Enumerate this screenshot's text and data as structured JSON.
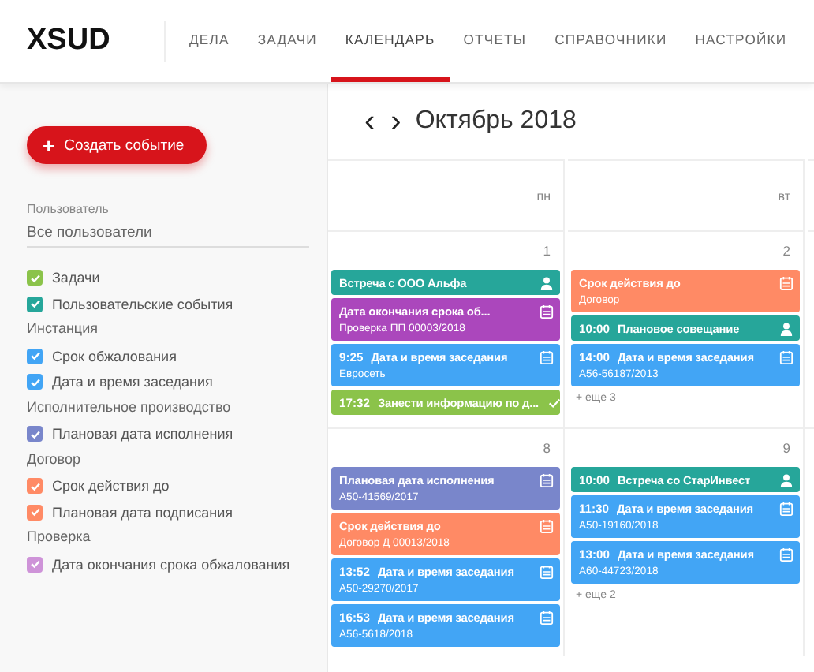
{
  "logo": "XSUD",
  "nav": [
    {
      "label": "ДЕЛА",
      "selected": false
    },
    {
      "label": "ЗАДАЧИ",
      "selected": false
    },
    {
      "label": "КАЛЕНДАРЬ",
      "selected": true
    },
    {
      "label": "ОТЧЕТЫ",
      "selected": false
    },
    {
      "label": "СПРАВОЧНИКИ",
      "selected": false
    },
    {
      "label": "НАСТРОЙКИ",
      "selected": false
    }
  ],
  "sidebar": {
    "create_button": "Создать событие",
    "create_icon": "+",
    "user_filter": {
      "label": "Пользователь",
      "value": "Все пользователи"
    },
    "filters": [
      {
        "kind": "checkbox",
        "label": "Задачи",
        "checked": true,
        "color": "#8bc34a"
      },
      {
        "kind": "checkbox",
        "label": "Пользовательские события",
        "checked": true,
        "color": "#26a69a"
      },
      {
        "kind": "group",
        "label": "Инстанция"
      },
      {
        "kind": "checkbox",
        "label": "Срок обжалования",
        "checked": true,
        "color": "#42a5f5"
      },
      {
        "kind": "checkbox",
        "label": "Дата и время заседания",
        "checked": true,
        "color": "#42a5f5"
      },
      {
        "kind": "group",
        "label": "Исполнительное производство"
      },
      {
        "kind": "checkbox",
        "label": "Плановая дата исполнения",
        "checked": true,
        "color": "#7986cb"
      },
      {
        "kind": "group",
        "label": "Договор"
      },
      {
        "kind": "checkbox",
        "label": "Срок действия до",
        "checked": true,
        "color": "#ff8a65"
      },
      {
        "kind": "checkbox",
        "label": "Плановая дата подписания",
        "checked": true,
        "color": "#ff8a65"
      },
      {
        "kind": "group",
        "label": "Проверка"
      },
      {
        "kind": "checkbox",
        "label": "Дата окончания срока обжалования",
        "checked": true,
        "color": "#ce93d8"
      }
    ]
  },
  "calendar": {
    "prev": "‹",
    "next": "›",
    "month": "Октябрь 2018",
    "weekdays": [
      "пн",
      "вт"
    ],
    "weeks": [
      {
        "days": [
          {
            "number": "1",
            "events": [
              {
                "kind": "meeting",
                "title": "Встреча с ООО Альфа",
                "color": "#26a69a"
              },
              {
                "kind": "deadline",
                "title": "Дата окончания срока об...",
                "subtitle": "Проверка ПП 00003/2018",
                "color": "#ab47bc"
              },
              {
                "kind": "deadline",
                "time": "9:25",
                "title": "Дата и время заседания",
                "subtitle": "Евросеть",
                "color": "#42a5f5"
              },
              {
                "kind": "task",
                "time": "17:32",
                "title": "Занести информацию по д...",
                "color": "#8bc34a"
              }
            ]
          },
          {
            "number": "2",
            "events": [
              {
                "kind": "deadline",
                "title": "Срок действия до",
                "subtitle": "Договор",
                "color": "#ff8a65"
              },
              {
                "kind": "meeting",
                "time": "10:00",
                "title": "Плановое совещание",
                "color": "#26a69a"
              },
              {
                "kind": "deadline",
                "time": "14:00",
                "title": "Дата и время заседания",
                "subtitle": "А56-56187/2013",
                "color": "#42a5f5"
              }
            ],
            "more": "+ еще 3"
          }
        ]
      },
      {
        "days": [
          {
            "number": "8",
            "events": [
              {
                "kind": "deadline",
                "title": "Плановая дата исполнения",
                "subtitle": "А50-41569/2017",
                "color": "#7986cb"
              },
              {
                "kind": "deadline",
                "title": "Срок действия до",
                "subtitle": "Договор Д 00013/2018",
                "color": "#ff8a65"
              },
              {
                "kind": "deadline",
                "time": "13:52",
                "title": "Дата и время заседания",
                "subtitle": "А50-29270/2017",
                "color": "#42a5f5"
              },
              {
                "kind": "deadline",
                "time": "16:53",
                "title": "Дата и время заседания",
                "subtitle": "А56-5618/2018",
                "color": "#42a5f5"
              }
            ]
          },
          {
            "number": "9",
            "events": [
              {
                "kind": "meeting",
                "time": "10:00",
                "title": "Встреча со СтарИнвест",
                "color": "#26a69a"
              },
              {
                "kind": "deadline",
                "time": "11:30",
                "title": "Дата и время заседания",
                "subtitle": "А50-19160/2018",
                "color": "#42a5f5"
              },
              {
                "kind": "deadline",
                "time": "13:00",
                "title": "Дата и время заседания",
                "subtitle": "А60-44723/2018",
                "color": "#42a5f5"
              }
            ],
            "more": "+ еще 2"
          }
        ]
      }
    ]
  }
}
